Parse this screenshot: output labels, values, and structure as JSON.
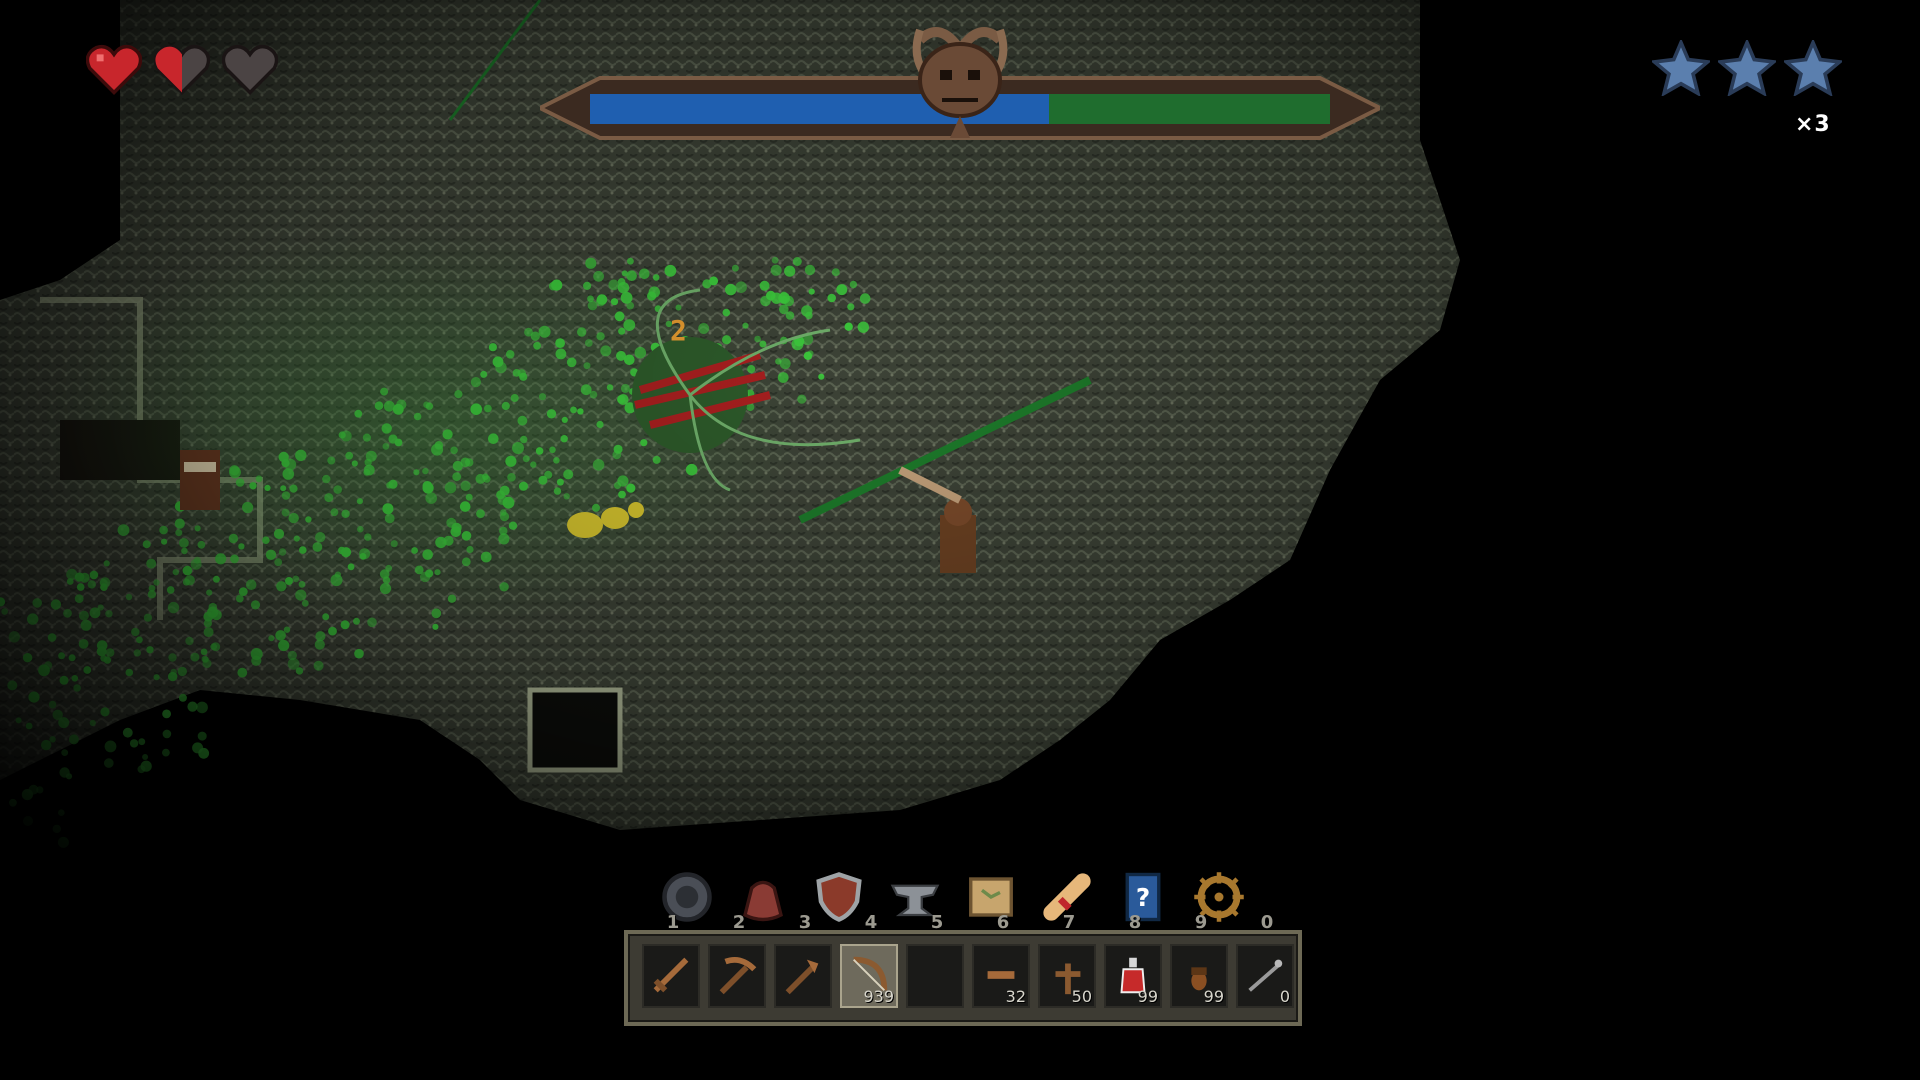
{
  "player": {
    "hearts": [
      {
        "name": "heart-full-icon",
        "fill": 1.0
      },
      {
        "name": "heart-half-icon",
        "fill": 0.5
      },
      {
        "name": "heart-empty-icon",
        "fill": 0.0
      }
    ]
  },
  "difficulty": {
    "stars": [
      "star-icon",
      "star-icon",
      "star-icon"
    ],
    "star_color": "#5b7fae"
  },
  "boss": {
    "multiplier": "×3",
    "health_fill": 0.62,
    "colors": {
      "health": "#1f5fb0",
      "background": "#1f6d2e",
      "frame": "#7a5b44"
    }
  },
  "quick_menu": [
    {
      "icon": "compass-icon"
    },
    {
      "icon": "pouch-icon"
    },
    {
      "icon": "shield-icon"
    },
    {
      "icon": "anvil-icon"
    },
    {
      "icon": "map-icon"
    },
    {
      "icon": "scroll-icon"
    },
    {
      "icon": "guide-book-icon"
    },
    {
      "icon": "settings-wheel-icon"
    }
  ],
  "hotbar": {
    "slots": [
      {
        "num": "1",
        "icon": "sword-icon",
        "count": ""
      },
      {
        "num": "2",
        "icon": "pickaxe-icon",
        "count": ""
      },
      {
        "num": "3",
        "icon": "axe-icon",
        "count": ""
      },
      {
        "num": "4",
        "icon": "bow-icon",
        "count": "939",
        "selected": true
      },
      {
        "num": "5",
        "icon": "",
        "count": ""
      },
      {
        "num": "6",
        "icon": "wood-plank-icon",
        "count": "32"
      },
      {
        "num": "7",
        "icon": "torch-icon",
        "count": "50"
      },
      {
        "num": "8",
        "icon": "health-potion-icon",
        "count": "99"
      },
      {
        "num": "9",
        "icon": "acorn-icon",
        "count": "99"
      },
      {
        "num": "0",
        "icon": "rope-icon",
        "count": "0"
      }
    ]
  },
  "world": {
    "damage_popup": "2",
    "colors": {
      "cave_wall": "#4a5042",
      "spores": "#39c23a",
      "enemy_ant": "#d9c930",
      "player": "#7a4a2a"
    }
  }
}
